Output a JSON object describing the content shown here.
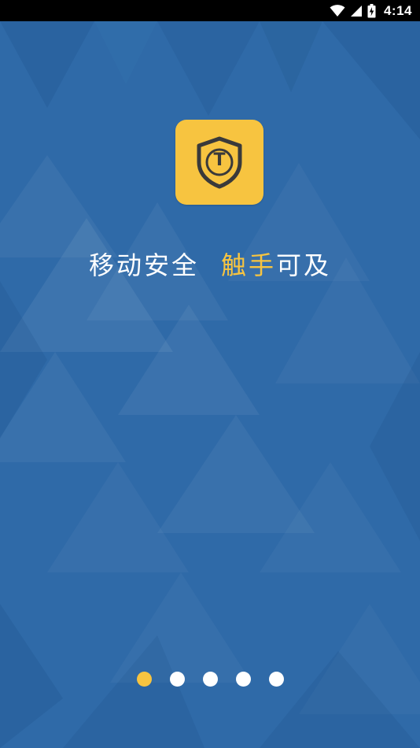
{
  "status_bar": {
    "time": "4:14",
    "icons": [
      "wifi-icon",
      "signal-icon",
      "battery-icon"
    ]
  },
  "app": {
    "logo_letter": "T",
    "logo_icon": "shield-icon"
  },
  "slogan": {
    "part1": "移动安全",
    "highlight": "触手",
    "part2": "可及"
  },
  "pager": {
    "total": 5,
    "active_index": 0
  },
  "colors": {
    "background": "#2f6aa8",
    "accent": "#f7c440",
    "text": "#ffffff",
    "status_bar": "#000000"
  }
}
